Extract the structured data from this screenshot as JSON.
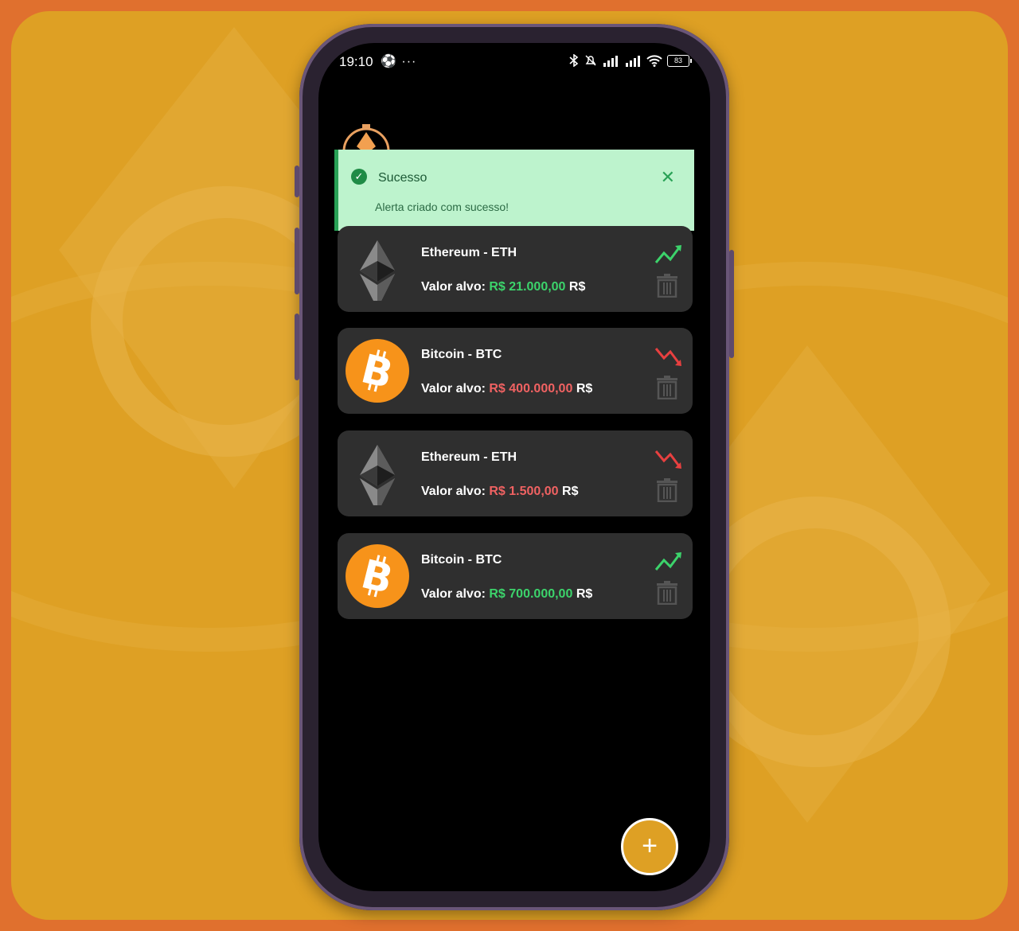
{
  "status_bar": {
    "time": "19:10",
    "extra": "⚽ ···",
    "battery": "83"
  },
  "toast": {
    "title": "Sucesso",
    "message": "Alerta criado com sucesso!",
    "close_glyph": "✕",
    "check_glyph": "✓"
  },
  "value_label": "Valor alvo:",
  "currency_suffix": "R$",
  "alerts": [
    {
      "name": "Ethereum - ETH",
      "price": "R$ 21.000,00",
      "direction": "up",
      "coin": "eth"
    },
    {
      "name": "Bitcoin - BTC",
      "price": "R$ 400.000,00",
      "direction": "down",
      "coin": "btc"
    },
    {
      "name": "Ethereum - ETH",
      "price": "R$ 1.500,00",
      "direction": "down",
      "coin": "eth"
    },
    {
      "name": "Bitcoin - BTC",
      "price": "R$ 700.000,00",
      "direction": "up",
      "coin": "btc"
    }
  ],
  "fab": {
    "glyph": "+"
  },
  "colors": {
    "up": "#3cd36b",
    "down": "#f06262",
    "accent": "#dea024",
    "bitcoin": "#f7931a"
  },
  "icons": [
    "check-circle-icon",
    "close-icon",
    "ethereum-icon",
    "bitcoin-icon",
    "trend-up-icon",
    "trend-down-icon",
    "trash-icon",
    "plus-icon",
    "bluetooth-icon",
    "mute-icon",
    "signal-icon",
    "wifi-icon",
    "battery-icon"
  ]
}
